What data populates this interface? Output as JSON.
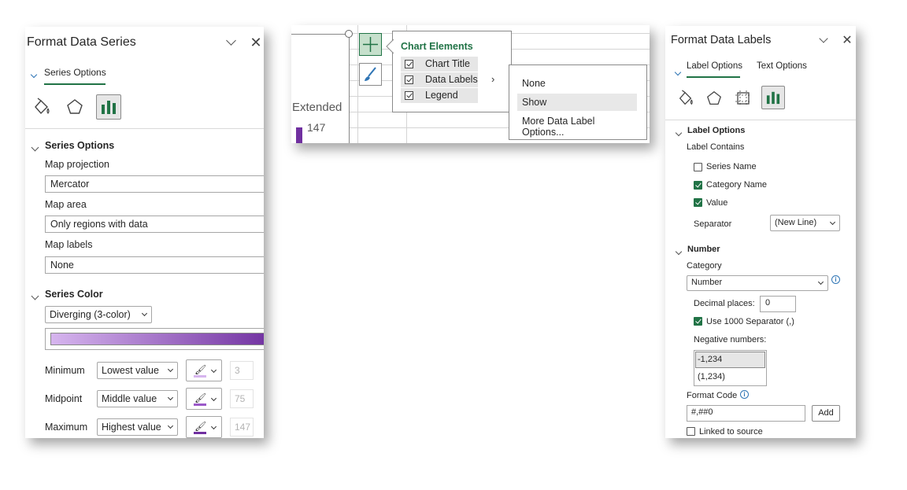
{
  "format_data_series": {
    "title": "Format Data Series",
    "tab": "Series Options",
    "section_series_options": "Series Options",
    "map_projection_label": "Map projection",
    "map_projection_value": "Mercator",
    "map_area_label": "Map area",
    "map_area_value": "Only regions with data",
    "map_labels_label": "Map labels",
    "map_labels_value": "None",
    "section_series_color": "Series Color",
    "color_mode": "Diverging (3-color)",
    "gradient_colors": [
      "#d6b5ee",
      "#7030a0"
    ],
    "rows": [
      {
        "label": "Minimum",
        "type": "Lowest value",
        "color": "#d6b5ee",
        "value": "3"
      },
      {
        "label": "Midpoint",
        "type": "Middle value",
        "color": "#9b59c9",
        "value": "75"
      },
      {
        "label": "Maximum",
        "type": "Highest value",
        "color": "#7030a0",
        "value": "147"
      }
    ]
  },
  "chart": {
    "partial_label": "Extended",
    "partial_value": "147",
    "bar_color": "#7030a0"
  },
  "chart_elements": {
    "title": "Chart Elements",
    "items": [
      "Chart Title",
      "Data Labels",
      "Legend"
    ],
    "submenu": [
      "None",
      "Show",
      "More Data Label Options..."
    ]
  },
  "format_data_labels": {
    "title": "Format Data Labels",
    "tabs": [
      "Label Options",
      "Text Options"
    ],
    "section_label_options": "Label Options",
    "label_contains": "Label Contains",
    "checkboxes": [
      {
        "label": "Series Name",
        "checked": false
      },
      {
        "label": "Category Name",
        "checked": true
      },
      {
        "label": "Value",
        "checked": true
      }
    ],
    "separator_label": "Separator",
    "separator_value": "(New Line)",
    "section_number": "Number",
    "category_label": "Category",
    "category_value": "Number",
    "decimal_label": "Decimal places:",
    "decimal_value": "0",
    "use_sep_label": "Use 1000 Separator (,)",
    "negative_label": "Negative numbers:",
    "negative_options": [
      "-1,234",
      "(1,234)"
    ],
    "format_code_label": "Format Code",
    "format_code_value": "#,##0",
    "add_button": "Add",
    "linked_label": "Linked to source"
  }
}
